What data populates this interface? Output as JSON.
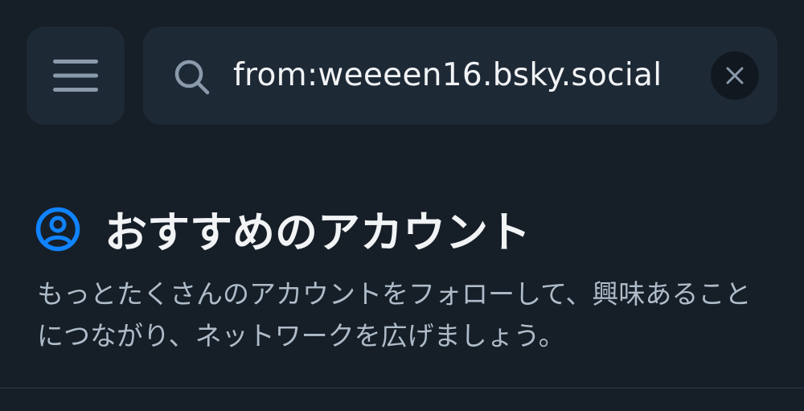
{
  "header": {
    "menu_icon": "hamburger-menu-icon",
    "search": {
      "icon": "search-icon",
      "value": "from:weeeen16.bsky.social",
      "clear_icon": "close-icon"
    }
  },
  "suggested_accounts": {
    "icon": "user-circle-icon",
    "title": "おすすめのアカウント",
    "description": "もっとたくさんのアカウントをフォローして、興味あることにつながり、ネットワークを広げましょう。"
  },
  "colors": {
    "background": "#161e27",
    "surface": "#1e2936",
    "accent": "#1083fe",
    "text_primary": "#f1f3f5",
    "text_secondary": "#aebbc9"
  }
}
